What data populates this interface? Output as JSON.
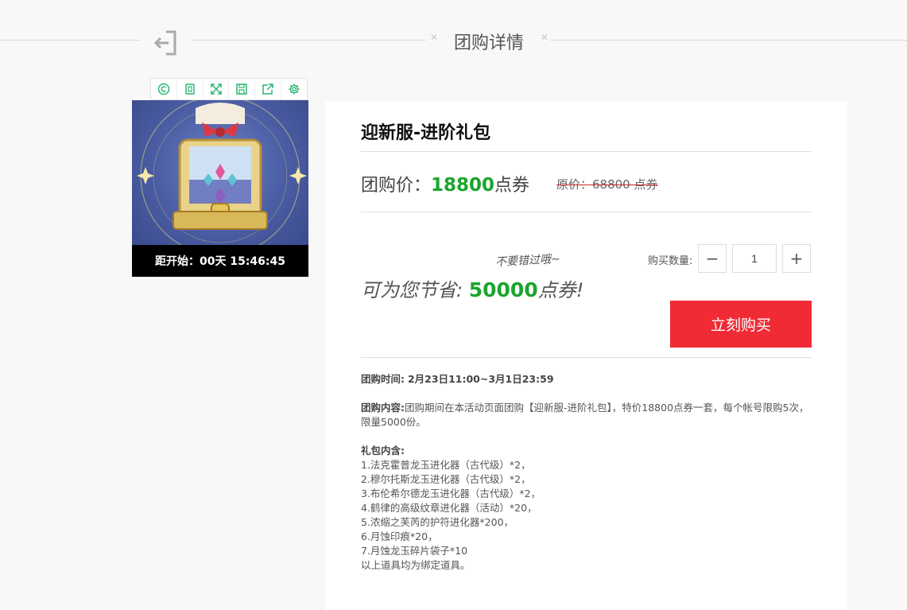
{
  "header": {
    "title": "团购详情",
    "back_icon": "exit-arrow-icon"
  },
  "toolbar": {
    "icons": [
      "copyright-icon",
      "copy-icon",
      "expand-icon",
      "save-icon",
      "share-icon",
      "gear-icon"
    ],
    "accent": "#2bb673"
  },
  "product": {
    "countdown": "距开始：00天 15:46:45",
    "title": "迎新服-进阶礼包",
    "price_label": "团购价：",
    "price_value": "18800",
    "price_unit": "点券",
    "original_price": "原价：68800 点券",
    "save_note": "不要错过哦~",
    "save_prefix": "可为您节省:",
    "save_value": "50000",
    "save_suffix": "点券!",
    "qty_label": "购买数量:",
    "qty_value": "1",
    "qty_minus": "−",
    "qty_plus": "+",
    "buy_label": "立刻购买",
    "colors": {
      "green": "#1aa52d",
      "buy": "#f02b36"
    }
  },
  "details": {
    "time_label": "团购时间:",
    "time_value": "2月23日11:00~3月1日23:59",
    "content_label": "团购内容:",
    "content_value": "团购期间在本活动页面团购【迎新服-进阶礼包】，特价18800点券一套，每个帐号限购5次，限量5000份。",
    "items_label": "礼包内含:",
    "items": [
      "1.法克霍普龙玉进化器（古代级）*2，",
      "2.穆尔托斯龙玉进化器（古代级）*2，",
      "3.布伦希尔德龙玉进化器（古代级）*2，",
      "4.鹤律的高级纹章进化器（活动）*20，",
      "5.浓缩之芙芮的护符进化器*200，",
      "6.月蚀印痕*20，",
      "7.月蚀龙玉碎片袋子*10"
    ],
    "footnote": "以上道具均为绑定道具。"
  }
}
